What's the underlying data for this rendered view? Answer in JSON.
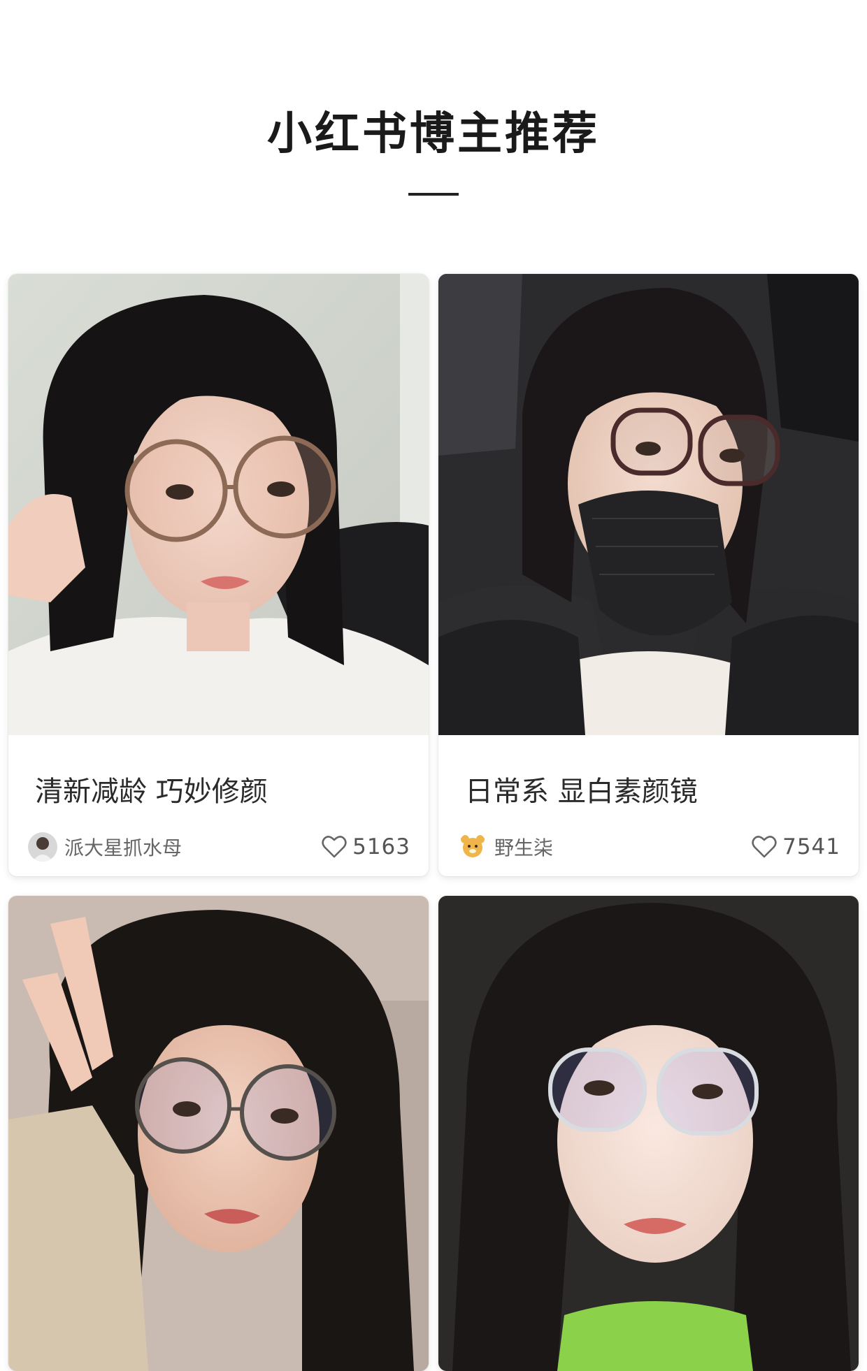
{
  "section": {
    "title": "小红书博主推荐"
  },
  "cards": [
    {
      "caption": "清新减龄 巧妙修颜",
      "author": "派大星抓水母",
      "likes": "5163",
      "avatar_icon": "avatar-photo-icon",
      "like_icon": "heart-outline-icon"
    },
    {
      "caption": "日常系 显白素颜镜",
      "author": "野生柒",
      "likes": "7541",
      "avatar_icon": "avatar-cartoon-icon",
      "like_icon": "heart-outline-icon"
    },
    {
      "caption": "",
      "author": "",
      "likes": ""
    },
    {
      "caption": "",
      "author": "",
      "likes": ""
    }
  ],
  "colors": {
    "background": "#ffffff",
    "title": "#1a1a1a",
    "caption": "#2a2a2a",
    "meta": "#666666"
  }
}
